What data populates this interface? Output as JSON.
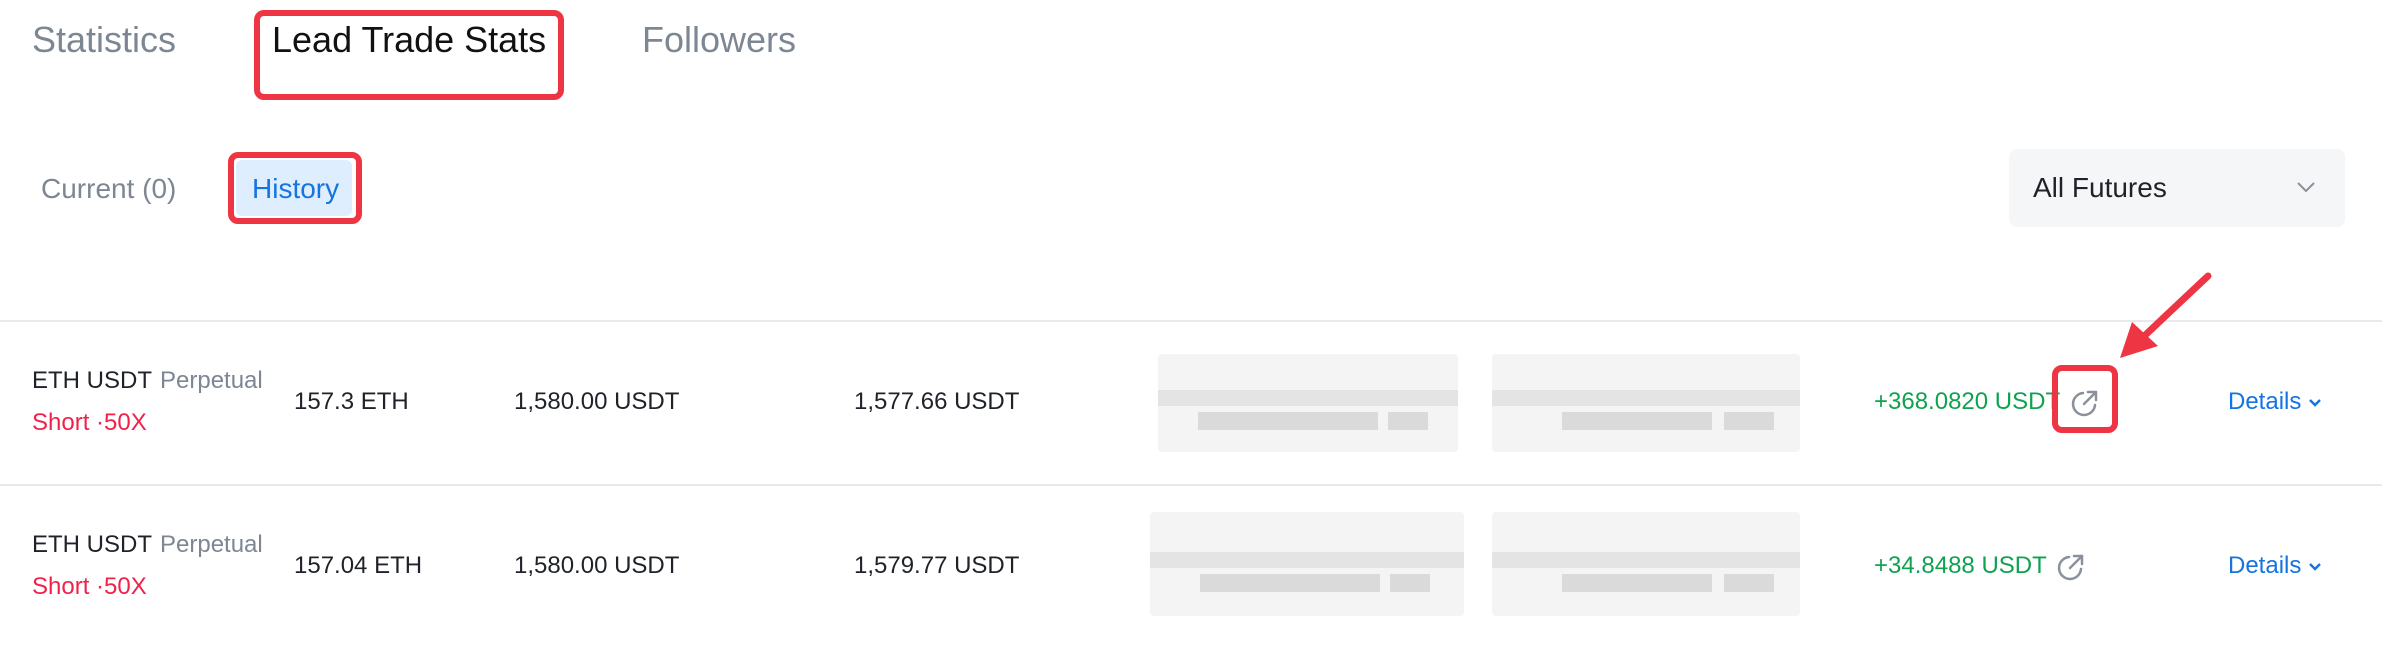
{
  "tabs": {
    "statistics": "Statistics",
    "lead_trade_stats": "Lead Trade Stats",
    "followers": "Followers"
  },
  "subtabs": {
    "current": "Current (0)",
    "history": "History"
  },
  "filter": {
    "selected": "All Futures"
  },
  "colors": {
    "accent": "#1474e0",
    "short": "#f0224a",
    "profit": "#0fa350",
    "annotation": "#ee3543"
  },
  "rows": [
    {
      "symbol": "ETH USDT",
      "type": "Perpetual",
      "side": "Short ·50X",
      "size": "157.3 ETH",
      "entry": "1,580.00 USDT",
      "exit": "1,577.66 USDT",
      "pnl": "+368.0820 USDT",
      "details": "Details"
    },
    {
      "symbol": "ETH USDT",
      "type": "Perpetual",
      "side": "Short ·50X",
      "size": "157.04 ETH",
      "entry": "1,580.00 USDT",
      "exit": "1,579.77 USDT",
      "pnl": "+34.8488 USDT",
      "details": "Details"
    }
  ]
}
